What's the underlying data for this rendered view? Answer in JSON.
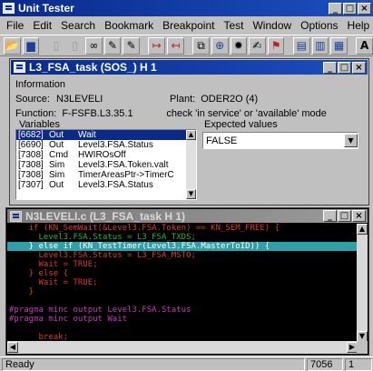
{
  "app": {
    "title": "Unit Tester",
    "window_buttons": [
      "_",
      "□",
      "×"
    ]
  },
  "menu": [
    "File",
    "Edit",
    "Search",
    "Bookmark",
    "Breakpoint",
    "Test",
    "Window",
    "Options",
    "Help"
  ],
  "toolbar": {
    "tools": [
      {
        "icon": "open-folder-icon",
        "glyph": "📂"
      },
      {
        "icon": "save-icon",
        "glyph": "▆"
      },
      {
        "icon": "blank-doc-icon",
        "glyph": "▯"
      },
      {
        "icon": "blank-doc2-icon",
        "glyph": "▯"
      },
      {
        "icon": "binoculars-icon",
        "glyph": "∞"
      },
      {
        "icon": "find-replace-icon",
        "glyph": "✎"
      },
      {
        "icon": "find-next-icon",
        "glyph": "✎"
      },
      {
        "icon": "step-into-icon",
        "glyph": "↦"
      },
      {
        "icon": "step-over-icon",
        "glyph": "↤"
      },
      {
        "icon": "test-icon",
        "glyph": "⧉"
      },
      {
        "icon": "target-icon",
        "glyph": "⊕"
      },
      {
        "icon": "gear-icon",
        "glyph": "✹"
      },
      {
        "icon": "edit-icon",
        "glyph": "✍"
      },
      {
        "icon": "run-icon",
        "glyph": "⚑"
      },
      {
        "icon": "window-cascade-icon",
        "glyph": "▤"
      },
      {
        "icon": "window-tile-icon",
        "glyph": "▥"
      },
      {
        "icon": "window-arrange-icon",
        "glyph": "▦"
      },
      {
        "icon": "font-icon",
        "glyph": "A"
      }
    ]
  },
  "task_window": {
    "title": "L3_FSA_task (SOS_) H 1",
    "info_label": "Information",
    "source_label": "Source:",
    "source_value": "N3LEVELI",
    "plant_label": "Plant:",
    "plant_value": "ODER2O (4)",
    "function_label": "Function:",
    "function_value": "F-FSFB.L3.35.1",
    "function_note": "check 'in service' or 'available' mode",
    "variables_label": "Variables",
    "expected_label": "Expected values",
    "expected_value": "FALSE",
    "variables": [
      {
        "id": "[6682]",
        "type": "Out",
        "name": "Wait",
        "selected": true
      },
      {
        "id": "[6690]",
        "type": "Out",
        "name": "Level3.FSA.Status",
        "selected": false
      },
      {
        "id": "[7308]",
        "type": "Cmd",
        "name": "HWIROsOff",
        "selected": false
      },
      {
        "id": "[7308]",
        "type": "Sim",
        "name": "Level3.FSA.Token.valt",
        "selected": false
      },
      {
        "id": "[7308]",
        "type": "Sim",
        "name": "TimerAreasPtr->TimerC",
        "selected": false
      },
      {
        "id": "[7307]",
        "type": "Out",
        "name": "Level3.FSA.Status",
        "selected": false
      }
    ]
  },
  "code_window": {
    "title": "N3LEVELI.c (L3_FSA_task H 1)",
    "lines": [
      {
        "text": "    if (KN_SemWait(&Level3.FSA.Token) == KN_SEM_FREE) {",
        "style": "red"
      },
      {
        "text": "      Level3.FSA.Status = L3_FSA_TXDS;",
        "style": "green"
      },
      {
        "text": "    } else if (KN_TestTimer(Level3.FSA.MasterToID)) {",
        "style": "hl"
      },
      {
        "text": "      Level3.FSA.Status = L3_FSA_MSTO;",
        "style": "red"
      },
      {
        "text": "      Wait = TRUE;",
        "style": "red"
      },
      {
        "text": "    } else {",
        "style": "red"
      },
      {
        "text": "      Wait = TRUE;",
        "style": "red"
      },
      {
        "text": "    }",
        "style": "red"
      },
      {
        "text": "",
        "style": "red"
      },
      {
        "text": "#pragma minc output Level3.FSA.Status",
        "style": "magenta"
      },
      {
        "text": "#pragma minc output Wait",
        "style": "magenta"
      },
      {
        "text": "",
        "style": "red"
      },
      {
        "text": "      break;",
        "style": "red"
      }
    ]
  },
  "statusbar": {
    "status": "Ready",
    "line": "7056",
    "col": "1"
  }
}
